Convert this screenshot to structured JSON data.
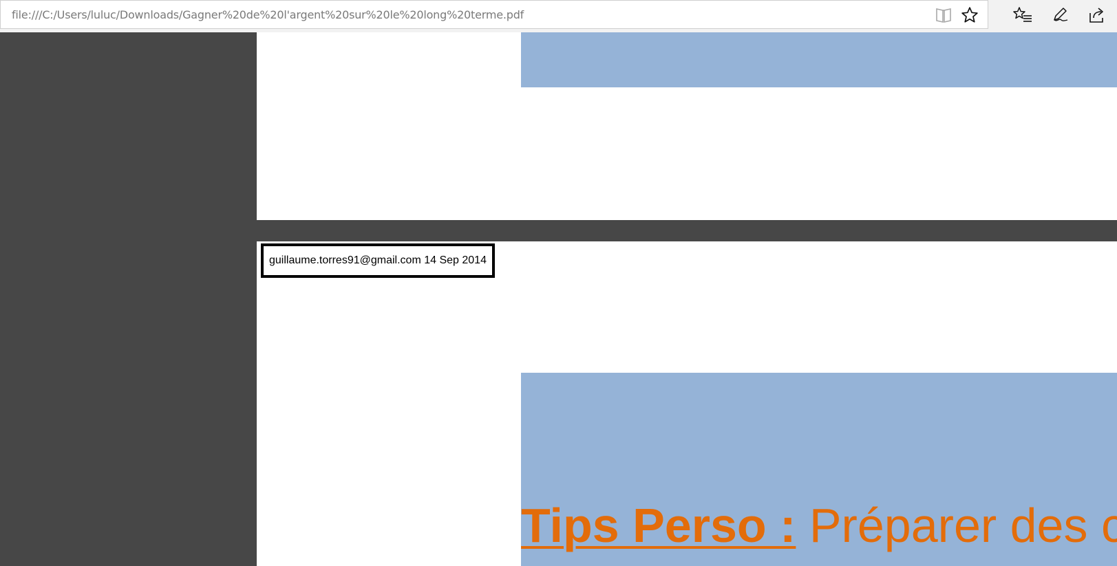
{
  "address_bar": {
    "url": "file:///C:/Users/luluc/Downloads/Gagner%20de%20l'argent%20sur%20le%20long%20terme.pdf"
  },
  "toolbar_icons": {
    "reading_view": "reading-view-icon",
    "favorite": "star-icon",
    "favorites_hub": "favorites-list-icon",
    "web_note": "pen-icon",
    "share": "share-icon"
  },
  "document": {
    "page2": {
      "stamp_text": "guillaume.torres91@gmail.com 14 Sep 2014",
      "heading_bold": "Tips Perso :",
      "heading_rest": " Préparer des c"
    }
  },
  "colors": {
    "viewer_background": "#474747",
    "block_blue": "#95b3d7",
    "heading_orange": "#e36c0a"
  }
}
